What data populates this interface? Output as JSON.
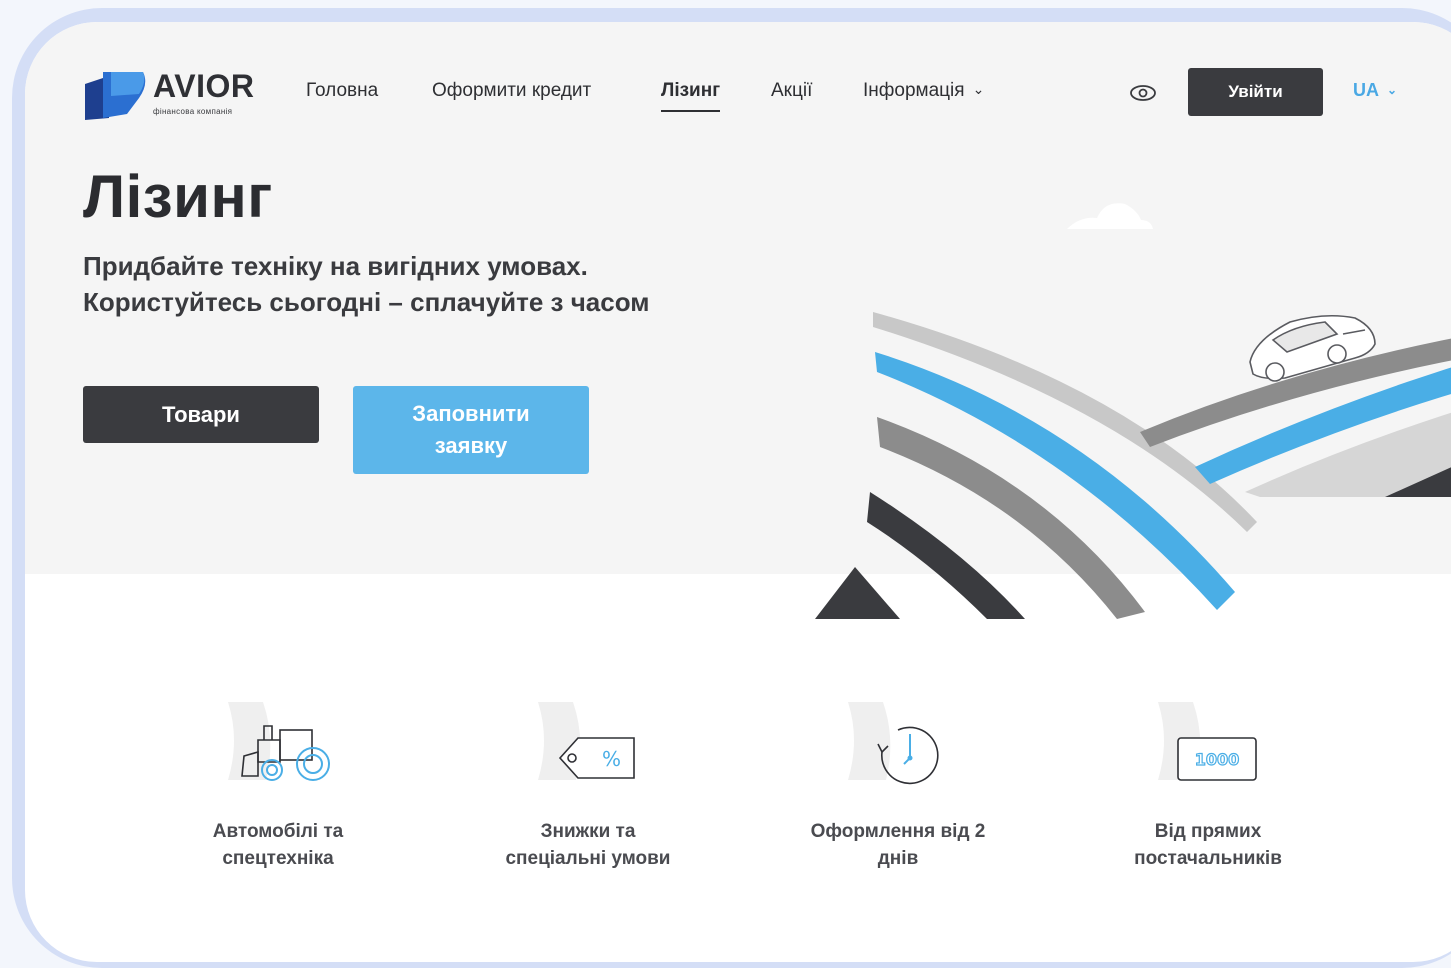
{
  "brand": {
    "name": "AVIOR",
    "tagline": "фінансова компанія",
    "colors": {
      "dark": "#3a3b3f",
      "accent": "#5cb6ea",
      "nav_blue": "#4aa8e4"
    }
  },
  "nav": {
    "items": [
      {
        "label": "Головна",
        "active": false
      },
      {
        "label": "Оформити кредит",
        "active": false
      },
      {
        "label": "Лізинг",
        "active": true
      },
      {
        "label": "Акції",
        "active": false
      },
      {
        "label": "Інформація",
        "active": false,
        "dropdown": true
      }
    ],
    "accessibility_icon": "eye-icon",
    "login_label": "Увійти",
    "language": "UA"
  },
  "hero": {
    "title": "Лізинг",
    "subtitle_line1": "Придбайте техніку на вигідних умовах.",
    "subtitle_line2": "Користуйтесь сьогодні – сплачуйте з часом",
    "primary_button": "Товари",
    "secondary_button": "Заповнити заявку"
  },
  "features": [
    {
      "icon": "tractor-icon",
      "label_line1": "Автомобілі та",
      "label_line2": "спецтехніка"
    },
    {
      "icon": "discount-tag-icon",
      "label_line1": "Знижки та",
      "label_line2": "спеціальні умови"
    },
    {
      "icon": "clock-icon",
      "label_line1": "Оформлення від 2",
      "label_line2": "днів"
    },
    {
      "icon": "banknote-icon",
      "label_line1": "Від прямих",
      "label_line2": "постачальників",
      "banknote_text": "1000"
    }
  ]
}
